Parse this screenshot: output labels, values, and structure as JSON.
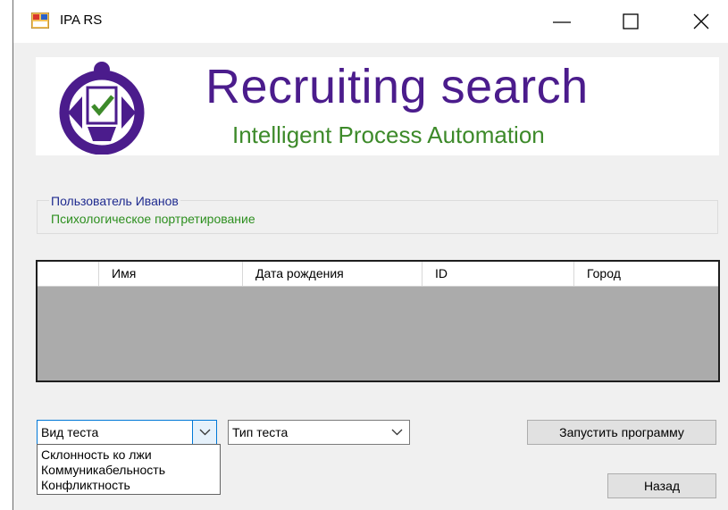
{
  "window": {
    "title": "IPA RS",
    "controls": {
      "minimize": "minimize-icon",
      "maximize": "maximize-icon",
      "close": "close-icon"
    }
  },
  "banner": {
    "title": "Recruiting search",
    "subtitle": "Intelligent Process Automation",
    "colors": {
      "title": "#4b1c8c",
      "subtitle": "#3d8a2a"
    }
  },
  "user_group": {
    "legend": "Пользователь Иванов",
    "text": "Психологическое портретирование"
  },
  "grid": {
    "columns": [
      "",
      "Имя",
      "Дата рождения",
      "ID",
      "Город"
    ],
    "rows": []
  },
  "test_kind": {
    "value": "Вид теста",
    "options": [
      "Склонность ко лжи",
      "Коммуникабельность",
      "Конфликтность"
    ]
  },
  "test_type": {
    "value": "Тип теста"
  },
  "buttons": {
    "run": "Запустить программу",
    "back": "Назад"
  },
  "accent": "#0078d7"
}
